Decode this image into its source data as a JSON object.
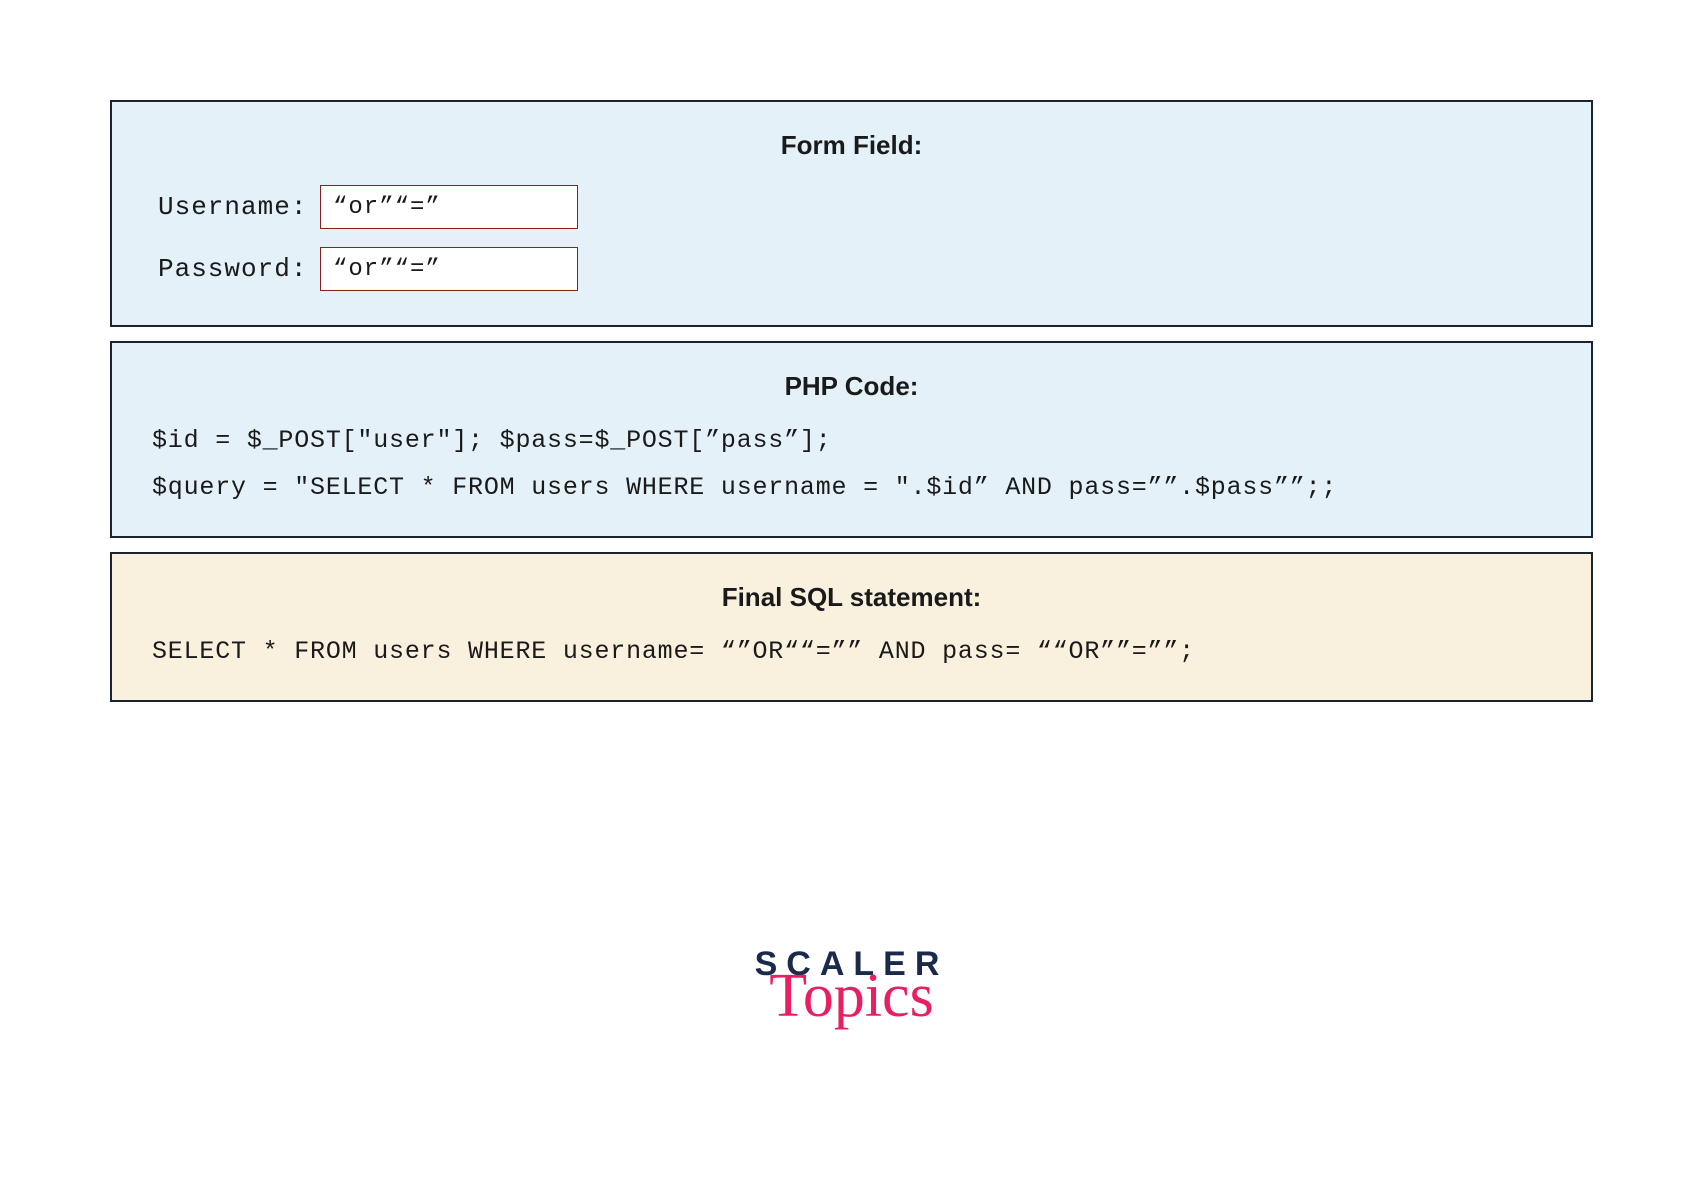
{
  "form_panel": {
    "title": "Form Field:",
    "username_label": "Username:",
    "username_value": "“or”“=”",
    "password_label": "Password:",
    "password_value": "“or”“=”"
  },
  "php_panel": {
    "title": "PHP Code:",
    "line1": "$id = $_POST[\"user\"]; $pass=$_POST[”pass”];",
    "line2": "$query = \"SELECT * FROM users WHERE username = \".$id” AND pass=””.$pass””;;"
  },
  "sql_panel": {
    "title": "Final SQL statement:",
    "line1": "SELECT * FROM users WHERE username= “”OR““=”” AND pass= ““OR””=””;"
  },
  "logo": {
    "brand": "SCALER",
    "subtitle": "Topics"
  }
}
